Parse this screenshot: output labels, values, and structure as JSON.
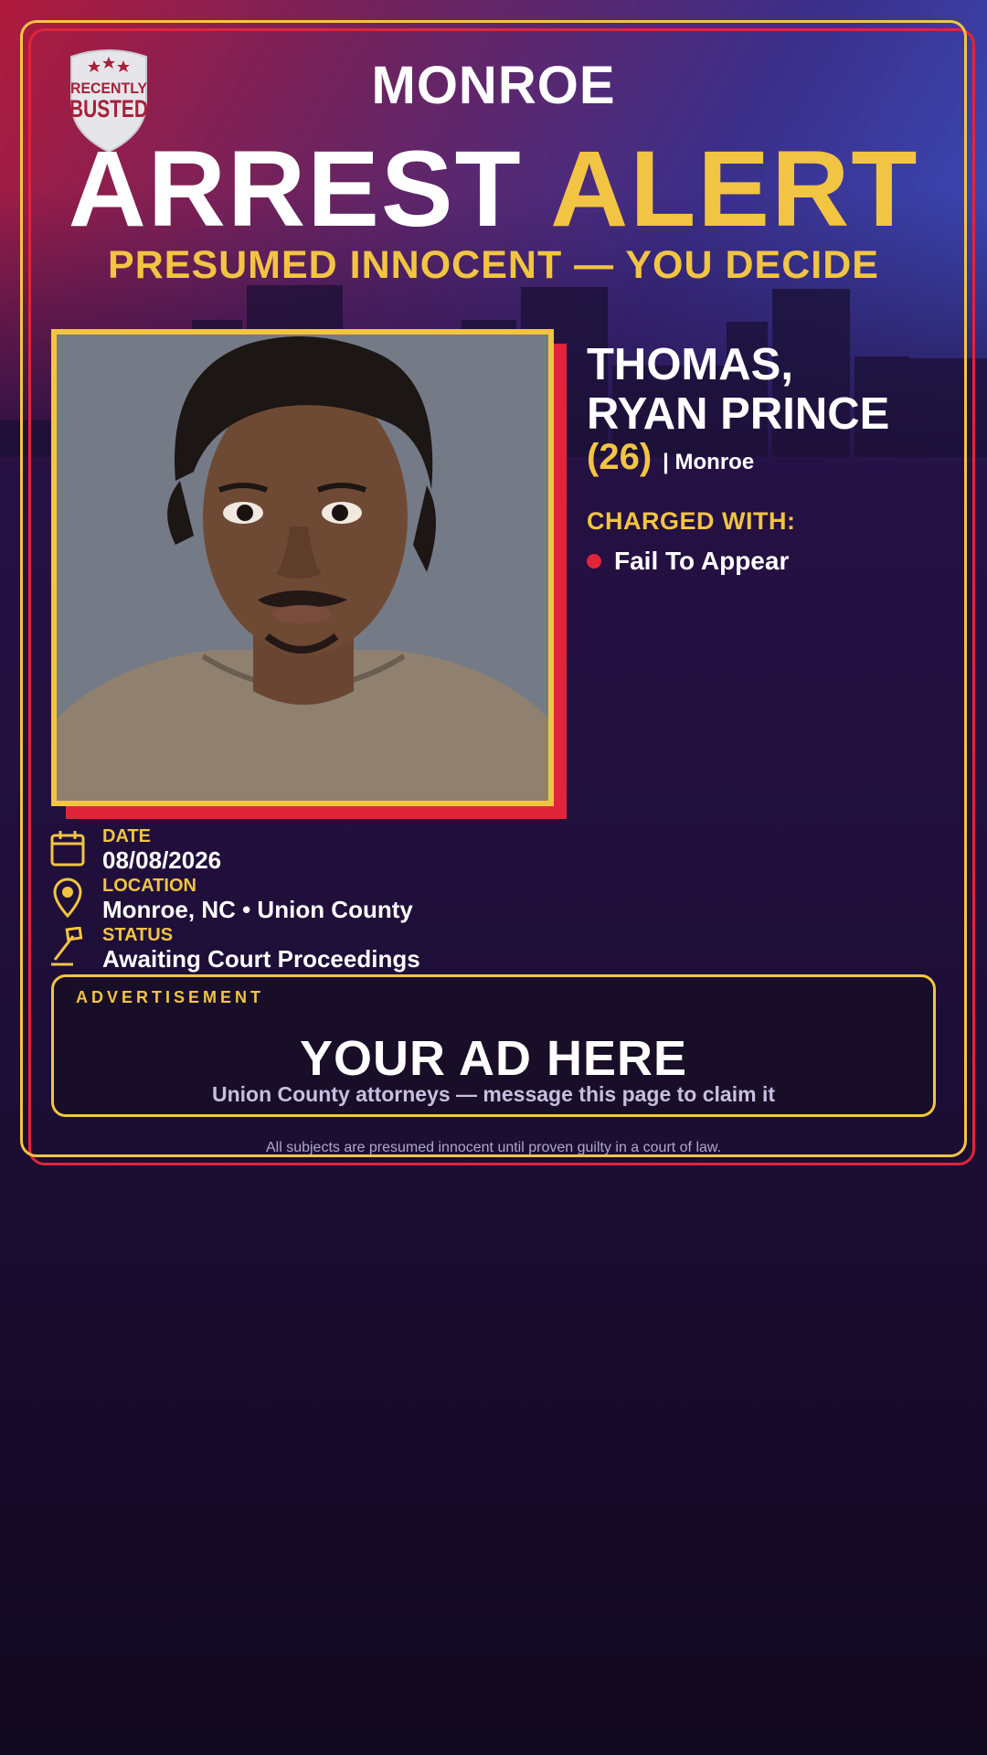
{
  "brand": {
    "badge_line1": "RECENTLY",
    "badge_line2": "BUSTED"
  },
  "header": {
    "city": "MONROE",
    "headline_white": "ARREST",
    "headline_gold": "ALERT",
    "subhead": "PRESUMED INNOCENT — YOU DECIDE"
  },
  "subject": {
    "name_line1": "THOMAS,",
    "name_line2": "RYAN PRINCE",
    "age": "(26)",
    "city": "| Monroe",
    "charged_label": "CHARGED WITH:",
    "charges": [
      "Fail To Appear"
    ]
  },
  "details": {
    "date_label": "DATE",
    "date_value": "08/08/2026",
    "location_label": "LOCATION",
    "location_value": "Monroe, NC • Union County",
    "status_label": "STATUS",
    "status_value": "Awaiting Court Proceedings"
  },
  "ad": {
    "label": "ADVERTISEMENT",
    "title": "YOUR AD HERE",
    "subtitle": "Union County attorneys — message this page to claim it"
  },
  "footer": {
    "disclaimer": "All subjects are presumed innocent until proven guilty in a court of law."
  },
  "colors": {
    "gold": "#f2c443",
    "red": "#e0253a",
    "navy": "#22103f"
  },
  "icons": [
    "calendar-icon",
    "location-pin-icon",
    "gavel-icon",
    "recently-busted-badge"
  ]
}
